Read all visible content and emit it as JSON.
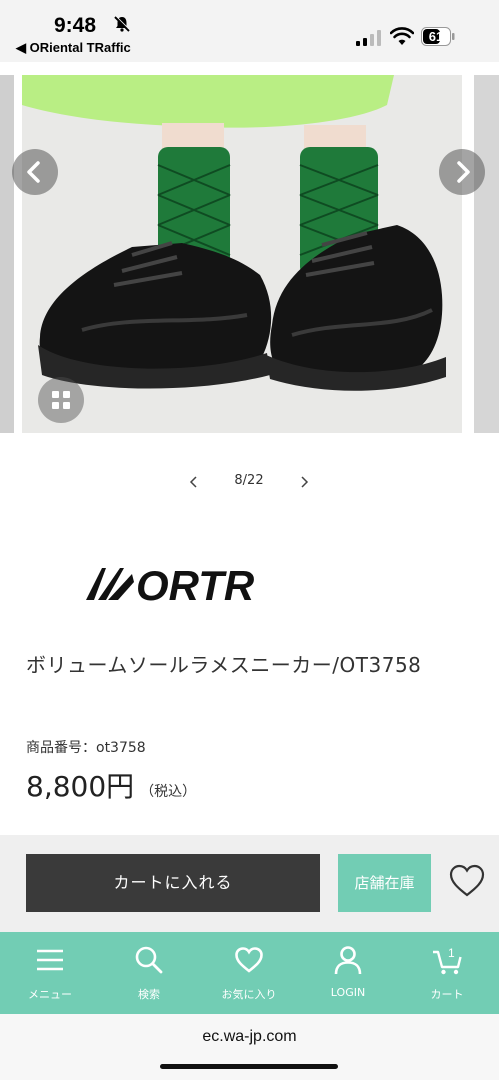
{
  "status_bar": {
    "time": "9:48",
    "back_app": "◀ ORiental TRaffic",
    "battery": "61"
  },
  "gallery": {
    "page_indicator": "8/22"
  },
  "brand": {
    "logo_text": "ORTR"
  },
  "product": {
    "name": "ボリュームソールラメスニーカー/OT3758",
    "sku_label": "商品番号：",
    "sku": "ot3758",
    "price": "8,800円",
    "tax_note": "（税込）"
  },
  "actions": {
    "add_to_cart": "カートに入れる",
    "store_stock": "店舗在庫"
  },
  "bottom_nav": {
    "items": [
      {
        "label": "メニュー",
        "icon": "menu-icon"
      },
      {
        "label": "検索",
        "icon": "search-icon"
      },
      {
        "label": "お気に入り",
        "icon": "heart-icon"
      },
      {
        "label": "LOGIN",
        "icon": "user-icon"
      },
      {
        "label": "カート",
        "icon": "cart-icon",
        "badge": "1"
      }
    ]
  },
  "browser": {
    "url": "ec.wa-jp.com"
  },
  "colors": {
    "accent": "#72cdb4",
    "cart_button": "#3a3a3a"
  }
}
